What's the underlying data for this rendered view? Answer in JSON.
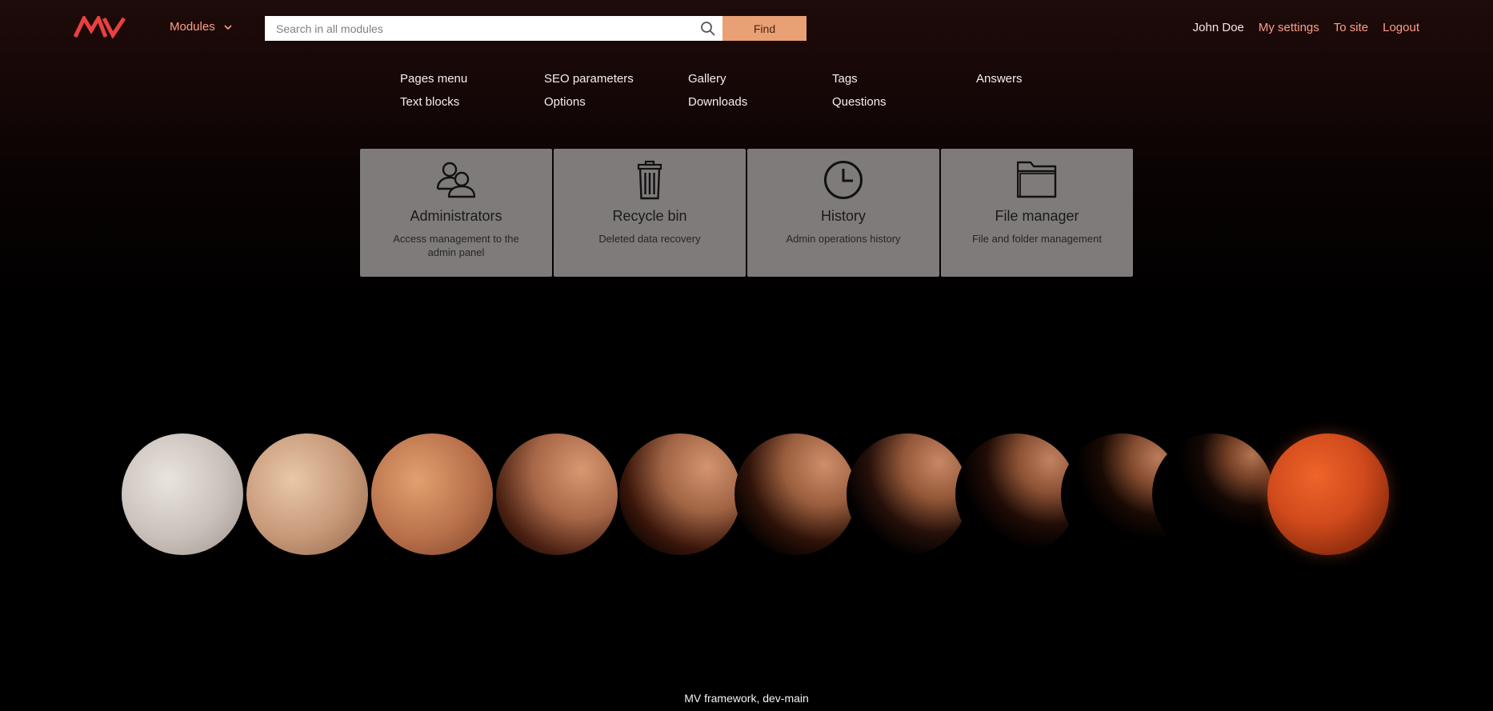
{
  "header": {
    "logo_alt": "MV",
    "modules_label": "Modules",
    "search": {
      "placeholder": "Search in all modules",
      "value": ""
    },
    "find_label": "Find",
    "user_name": "John Doe",
    "links": {
      "settings": "My settings",
      "site": "To site",
      "logout": "Logout"
    },
    "accent_color": "#ff9e87"
  },
  "modules_menu": [
    {
      "label": "Pages menu"
    },
    {
      "label": "SEO parameters"
    },
    {
      "label": "Gallery"
    },
    {
      "label": "Tags"
    },
    {
      "label": "Answers"
    },
    {
      "label": "Text blocks"
    },
    {
      "label": "Options"
    },
    {
      "label": "Downloads"
    },
    {
      "label": "Questions"
    }
  ],
  "tiles": [
    {
      "icon": "administrators-icon",
      "title": "Administrators",
      "desc": "Access management to the admin panel"
    },
    {
      "icon": "trash-icon",
      "title": "Recycle bin",
      "desc": "Deleted data recovery"
    },
    {
      "icon": "clock-icon",
      "title": "History",
      "desc": "Admin operations history"
    },
    {
      "icon": "folder-icon",
      "title": "File manager",
      "desc": "File and folder management"
    }
  ],
  "footer": {
    "text": "MV framework, dev-main"
  },
  "colors": {
    "find_button": "#e9a074",
    "tile_bg": "#7f7b7a",
    "logo": "#e8413f"
  }
}
